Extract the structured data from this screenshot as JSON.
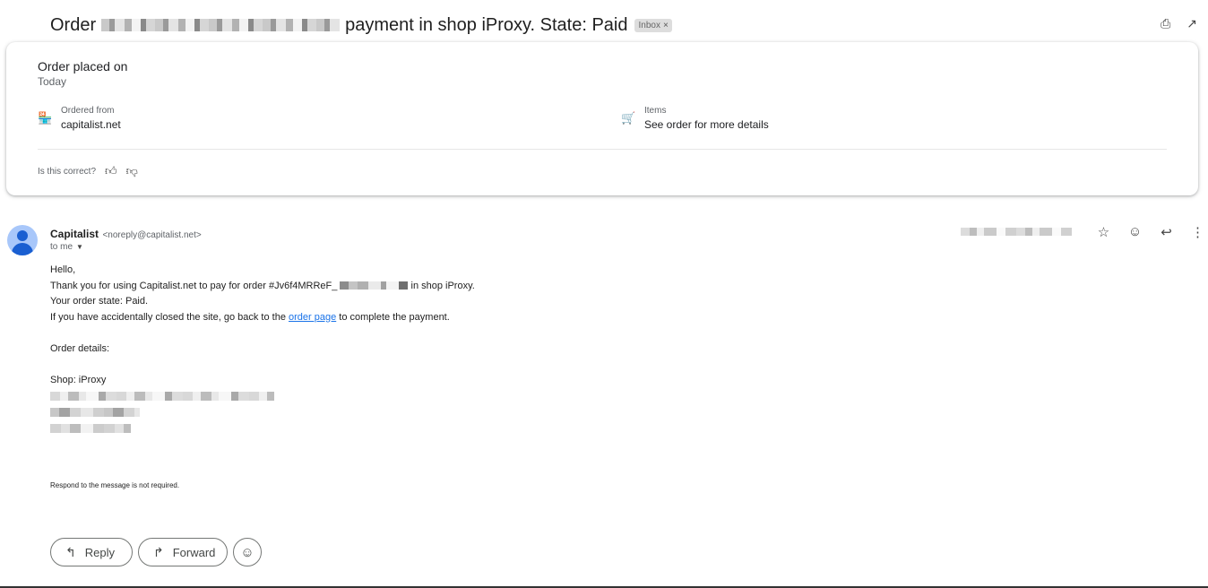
{
  "subject": {
    "prefix": "Order",
    "suffix": "payment in shop iProxy. State: Paid",
    "label_chip": "Inbox",
    "label_chip_close": "×"
  },
  "header_icons": {
    "print": "print-icon",
    "popout": "open-in-new-window-icon"
  },
  "order_card": {
    "title": "Order placed on",
    "subtitle": "Today",
    "ordered_from": {
      "label": "Ordered from",
      "value": "capitalist.net",
      "icon": "store-icon"
    },
    "items": {
      "label": "Items",
      "value": "See order for more details",
      "icon": "cart-icon"
    },
    "feedback_question": "Is this correct?"
  },
  "message": {
    "sender_name": "Capitalist",
    "sender_email": "<noreply@capitalist.net>",
    "to": "to me",
    "greeting": "Hello,",
    "line1_prefix": "Thank you for using Capitalist.net to pay for order #Jv6f4MRReF_",
    "line1_suffix": "in shop iProxy.",
    "line2": "Your order state: Paid.",
    "line3_prefix": "If you have accidentally closed the site, go back to the",
    "line3_link": "order page",
    "line3_suffix": "to complete the payment.",
    "details_heading": "Order details:",
    "shop_line": "Shop: iProxy",
    "footer_note": "Respond to the message is not required."
  },
  "actions": {
    "reply": "Reply",
    "forward": "Forward"
  },
  "colors": {
    "link": "#1a73e8",
    "avatar_bg": "#a8c7fa",
    "avatar_fg": "#1a5fd1"
  }
}
